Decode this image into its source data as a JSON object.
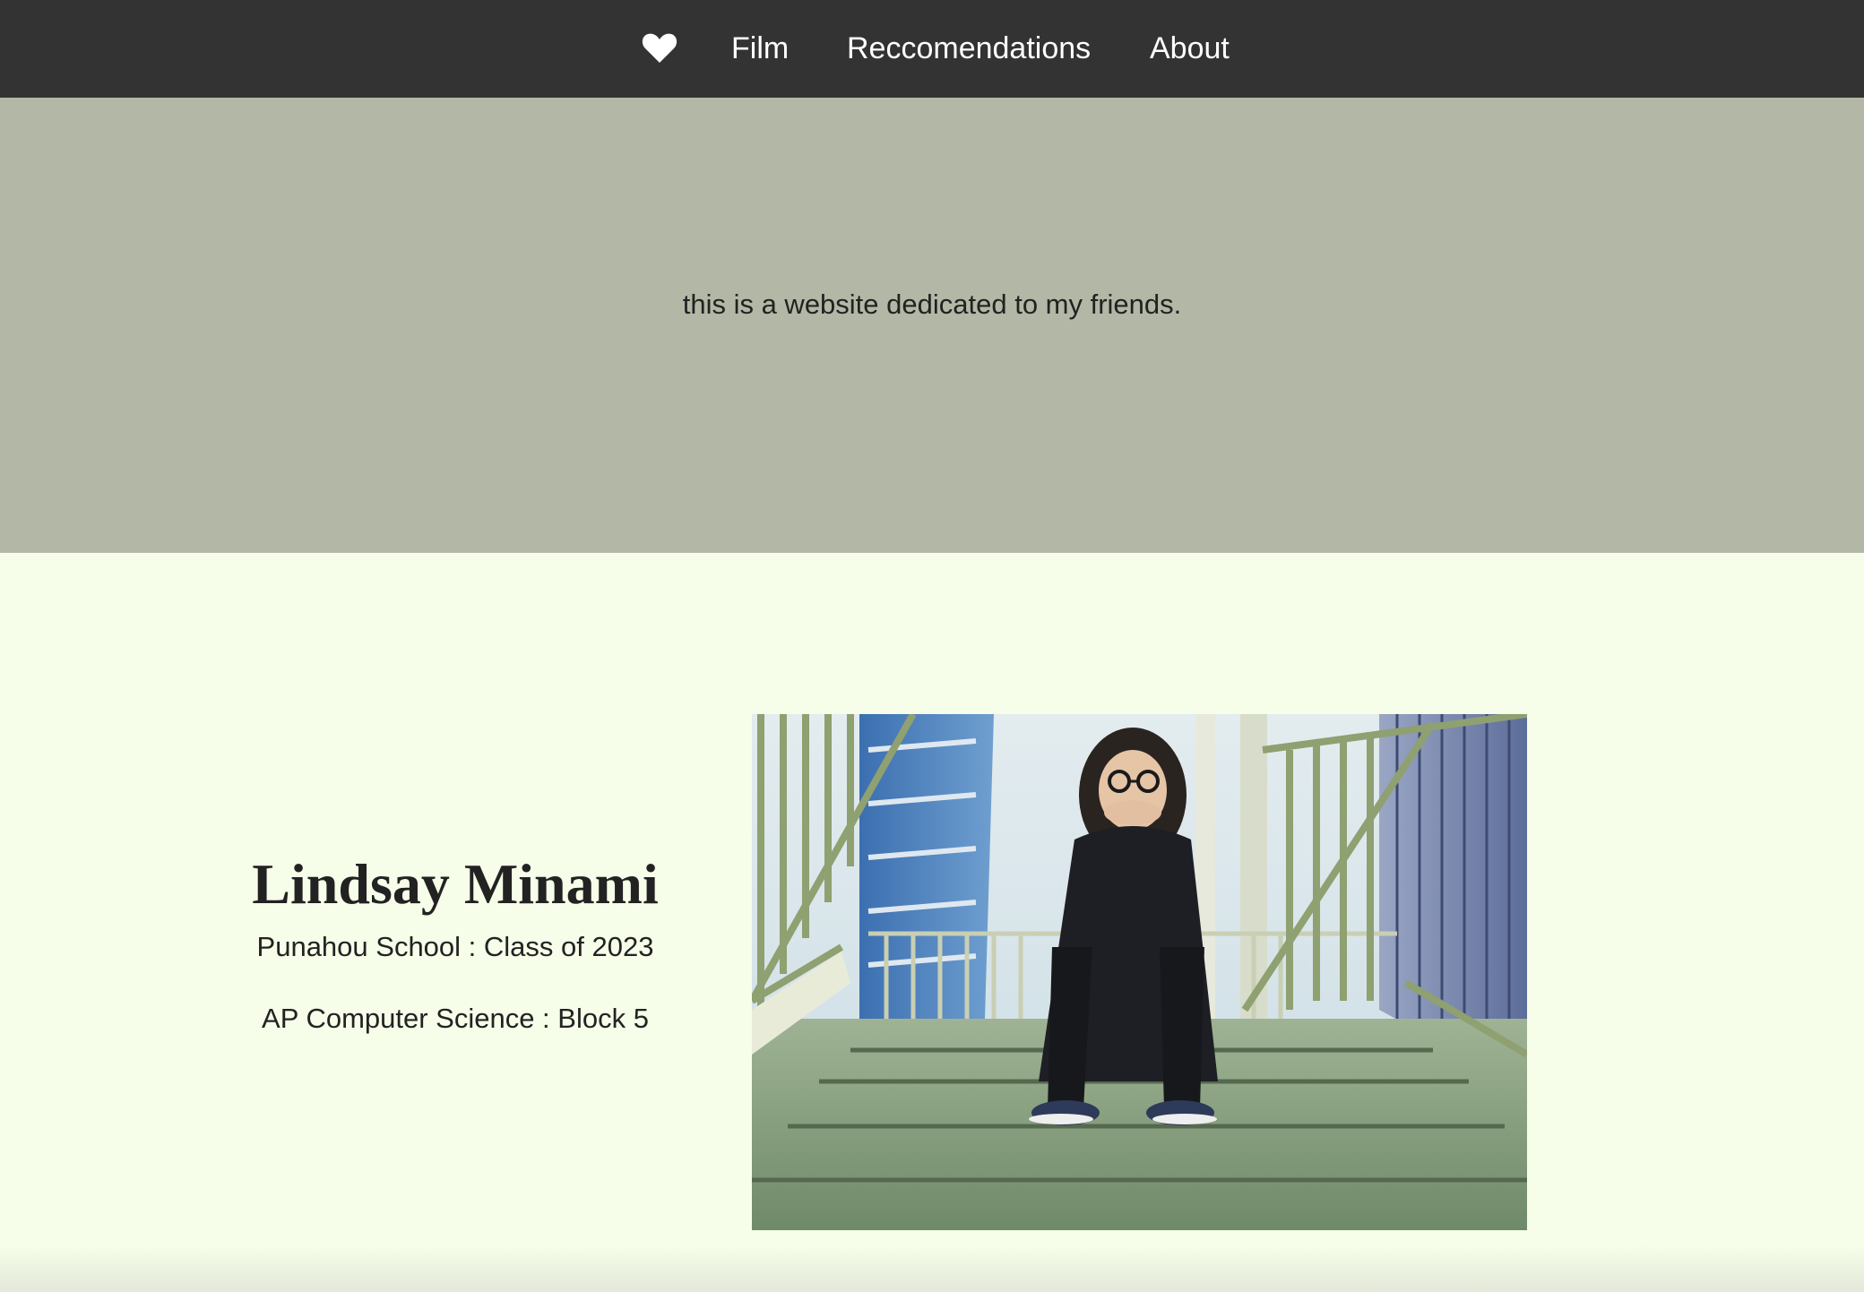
{
  "nav": {
    "heart_icon": "heart-icon",
    "items": [
      {
        "label": "Film"
      },
      {
        "label": "Reccomendations"
      },
      {
        "label": "About"
      }
    ]
  },
  "hero": {
    "text": "this is a website dedicated to my friends."
  },
  "profile": {
    "name": "Lindsay Minami",
    "school": "Punahou School : Class of 2023",
    "course": "AP Computer Science : Block 5",
    "photo_alt": "photo"
  },
  "colors": {
    "navbar": "#333333",
    "hero": "#b3b8a6",
    "background": "#f6fde8",
    "text": "#222222"
  }
}
